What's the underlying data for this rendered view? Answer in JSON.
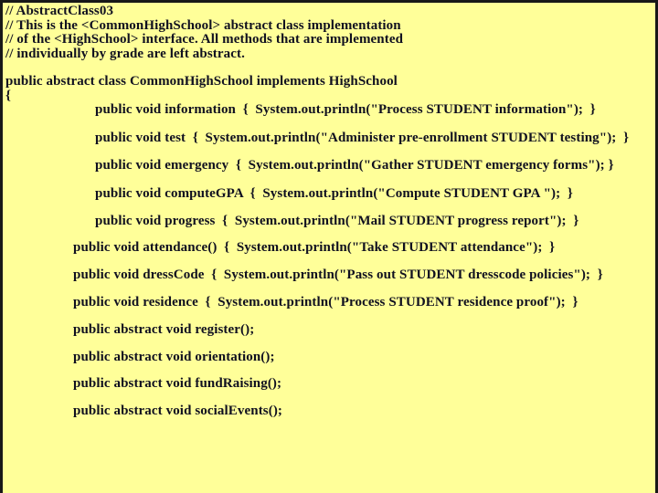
{
  "slide": {
    "title": "AbstractClass03",
    "background_color": "#ffff99",
    "border_color": "#181818",
    "text_color": "#101020"
  },
  "code": {
    "comments": [
      "// AbstractClass03",
      "// This is the <CommonHighSchool> abstract class implementation",
      "// of the <HighSchool> interface. All methods that are implemented",
      "// individually by grade are left abstract."
    ],
    "class_declaration": "public abstract class CommonHighSchool implements HighSchool",
    "open_brace": "{",
    "methods": [
      "public void information  {  System.out.println(\"Process STUDENT information\");  }",
      "public void test  {  System.out.println(\"Administer pre-enrollment STUDENT testing\");  }",
      "public void emergency  {  System.out.println(\"Gather STUDENT emergency forms\"); }",
      "public void computeGPA  {  System.out.println(\"Compute STUDENT GPA \");  }",
      "public void progress  {  System.out.println(\"Mail STUDENT progress report\");  }",
      "public void attendance()  {  System.out.println(\"Take STUDENT attendance\");  }",
      "public void dressCode  {  System.out.println(\"Pass out STUDENT dresscode policies\");  }",
      "public void residence  {  System.out.println(\"Process STUDENT residence proof\");  }"
    ],
    "abstract_methods": [
      "public abstract void register();",
      "public abstract void orientation();",
      "public abstract void fundRaising();",
      "public abstract void socialEvents();"
    ]
  }
}
